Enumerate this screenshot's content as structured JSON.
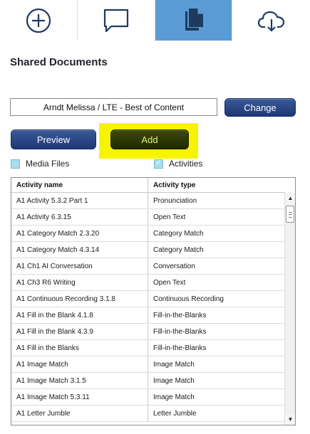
{
  "toolbar": {
    "tabs": [
      {
        "icon": "plus-circle-icon",
        "active": false
      },
      {
        "icon": "chat-icon",
        "active": false
      },
      {
        "icon": "documents-icon",
        "active": true
      },
      {
        "icon": "cloud-download-icon",
        "active": false
      }
    ],
    "accent": "#5b9bd5"
  },
  "page": {
    "title": "Shared Documents"
  },
  "resource": {
    "selected": "Arndt Melissa / LTE - Best of Content",
    "change_label": "Change"
  },
  "actions": {
    "preview_label": "Preview",
    "add_label": "Add",
    "highlight_color": "#f8f400"
  },
  "filters": {
    "media_files_label": "Media Files",
    "media_files_checked": false,
    "activities_label": "Activities",
    "activities_checked": true
  },
  "table": {
    "columns": [
      "Activity name",
      "Activity type"
    ],
    "rows": [
      [
        "A1 Activity 5.3.2 Part 1",
        "Pronunciation"
      ],
      [
        "A1 Activity 6.3.15",
        "Open Text"
      ],
      [
        "A1 Category Match 2.3.20",
        "Category Match"
      ],
      [
        "A1 Category Match 4.3.14",
        "Category Match"
      ],
      [
        "A1 Ch1 AI Conversation",
        "Conversation"
      ],
      [
        "A1 Ch3 R6 Writing",
        "Open Text"
      ],
      [
        "A1 Continuous Recording 3.1.8",
        "Continuous Recording"
      ],
      [
        "A1 Fill in the Blank 4.1.8",
        "Fill-in-the-Blanks"
      ],
      [
        "A1 Fill in the Blank 4.3.9",
        "Fill-in-the-Blanks"
      ],
      [
        "A1 Fill in the Blanks",
        "Fill-in-the-Blanks"
      ],
      [
        "A1 Image Match",
        "Image Match"
      ],
      [
        "A1 Image Match 3.1.5",
        "Image Match"
      ],
      [
        "A1 Image Match 5.3.11",
        "Image Match"
      ],
      [
        "A1 Letter Jumble",
        "Letter Jumble"
      ]
    ]
  }
}
